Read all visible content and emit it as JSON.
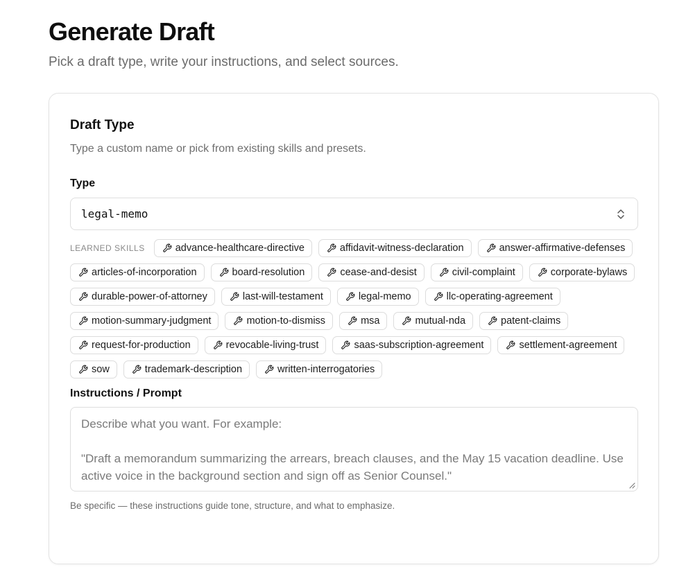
{
  "header": {
    "title": "Generate Draft",
    "subtitle": "Pick a draft type, write your instructions, and select sources."
  },
  "draft_type": {
    "title": "Draft Type",
    "description": "Type a custom name or pick from existing skills and presets.",
    "type_label": "Type",
    "selected_value": "legal-memo",
    "caret_icon": "chevron-up-down-icon",
    "skills_label": "LEARNED SKILLS",
    "skill_icon": "wrench-icon",
    "skills": [
      "advance-healthcare-directive",
      "affidavit-witness-declaration",
      "answer-affirmative-defenses",
      "articles-of-incorporation",
      "board-resolution",
      "cease-and-desist",
      "civil-complaint",
      "corporate-bylaws",
      "durable-power-of-attorney",
      "last-will-testament",
      "legal-memo",
      "llc-operating-agreement",
      "motion-summary-judgment",
      "motion-to-dismiss",
      "msa",
      "mutual-nda",
      "patent-claims",
      "request-for-production",
      "revocable-living-trust",
      "saas-subscription-agreement",
      "settlement-agreement",
      "sow",
      "trademark-description",
      "written-interrogatories"
    ]
  },
  "instructions": {
    "label": "Instructions / Prompt",
    "value": "",
    "placeholder": "Describe what you want. For example:\n\n\"Draft a memorandum summarizing the arrears, breach clauses, and the May 15 vacation deadline. Use active voice in the background section and sign off as Senior Counsel.\"",
    "hint": "Be specific — these instructions guide tone, structure, and what to emphasize."
  }
}
